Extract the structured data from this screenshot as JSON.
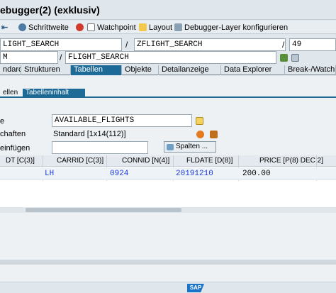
{
  "window": {
    "title": "ebugger(2)  (exklusiv)"
  },
  "toolbar": {
    "items": [
      "Schrittweite",
      "Watchpoint",
      "Layout",
      "Debugger-Layer  konfigurieren"
    ]
  },
  "source": {
    "row1": {
      "field_a": "LIGHT_SEARCH",
      "field_b": "ZFLIGHT_SEARCH",
      "line": "49"
    },
    "row2": {
      "field_a": "M",
      "field_b": "FLIGHT_SEARCH"
    }
  },
  "tabs": [
    "ndard",
    "Strukturen",
    "Tabellen",
    "Objekte",
    "Detailanzeige",
    "Data Explorer",
    "Break-/Watchpoints"
  ],
  "active_tab": "Tabellen",
  "subtabs": [
    "ellen",
    "Tabelleninhalt"
  ],
  "table_view": {
    "name_label": "e",
    "name_value": "AVAILABLE_FLIGHTS",
    "props_label": "chaften",
    "props_value": "Standard [1x14(112)]",
    "insert_label": "einfügen",
    "insert_value": "",
    "columns_button": "Spalten ..."
  },
  "grid": {
    "headers": [
      "DT [C(3)]",
      "CARRID [C(3)]",
      "CONNID [N(4)]",
      "FLDATE [D(8)]",
      "PRICE [P(8) DEC 2]"
    ],
    "rows": [
      [
        "",
        "LH",
        "0924",
        "20191210",
        "200.00"
      ]
    ]
  },
  "colors": {
    "accent": "#1d6a97",
    "link": "#1e3bd6"
  }
}
